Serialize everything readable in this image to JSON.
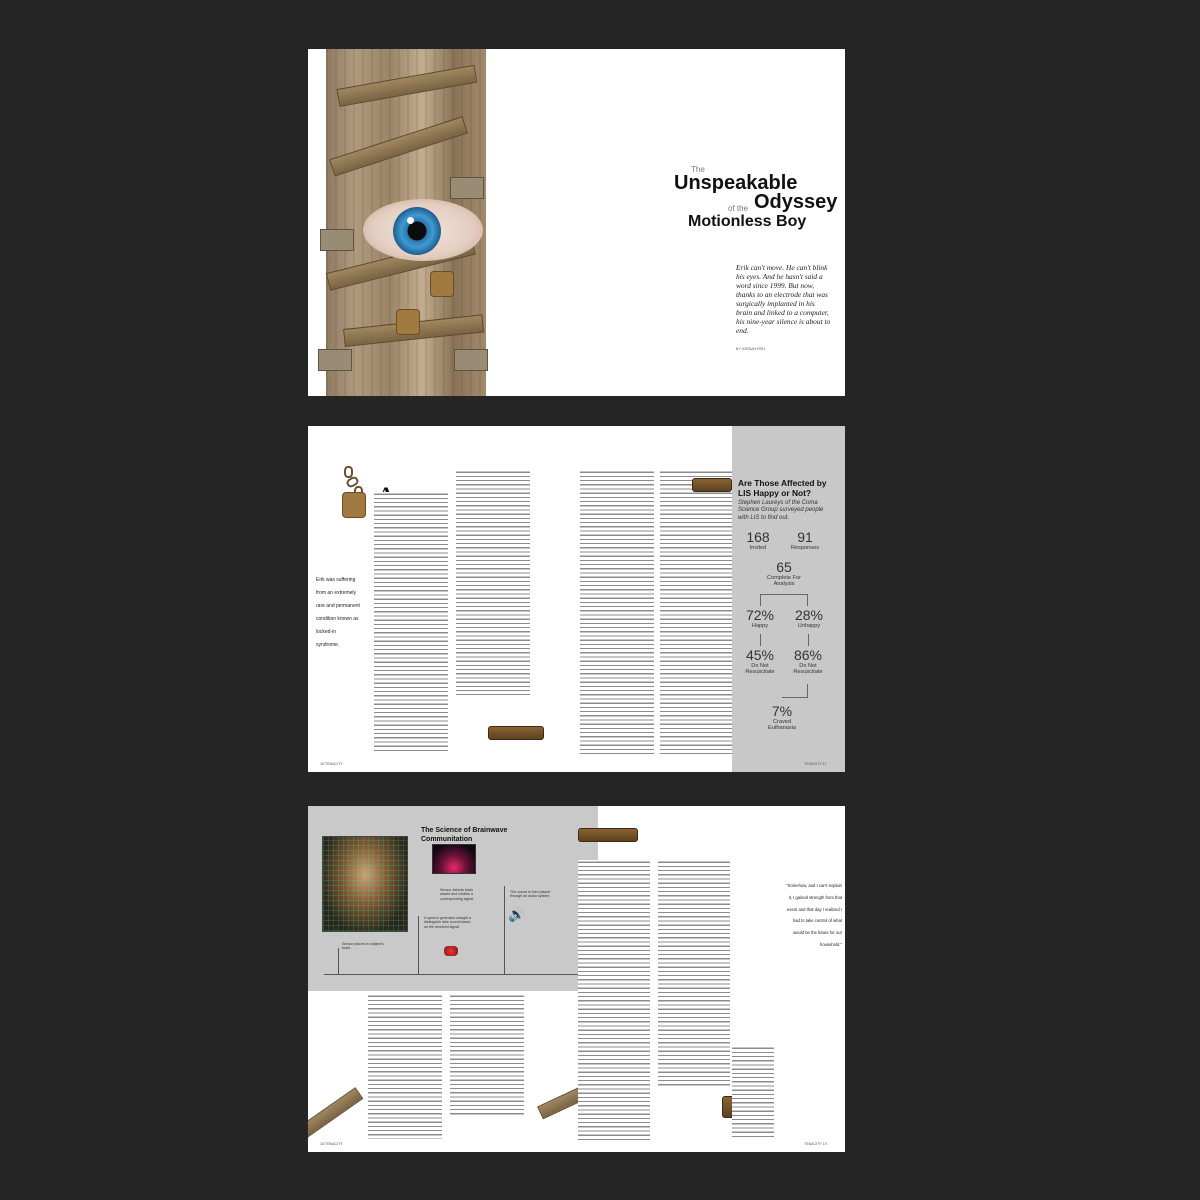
{
  "spread1": {
    "title_the": "The",
    "title_line1": "Unspeakable",
    "title_of_the": "of the",
    "title_line2": "Odyssey",
    "title_line3": "Motionless Boy",
    "deck": "Erik can't move. He can't blink his eyes. And he hasn't said a word since 1999. But now, thanks to an electrode that was surgically implanted in his brain and linked to a computer, his nine-year silence is about to end.",
    "byline": "BY JORDAN FISH"
  },
  "spread2": {
    "dropcap": "A",
    "pull_quote": "Erik was suffering from an extremely rare and permanent condition known as locked-in syndrome.",
    "sidebar": {
      "title": "Are Those Affected by LIS Happy or Not?",
      "subtitle": "Stephen Laureys of the Coma Science Group surveyed people with LIS to find out.",
      "stats": {
        "invited_n": "168",
        "invited_l": "Invited",
        "responses_n": "91",
        "responses_l": "Responses",
        "complete_n": "65",
        "complete_l": "Complete For Analysis",
        "happy_n": "72%",
        "happy_l": "Happy",
        "unhappy_n": "28%",
        "unhappy_l": "Unhappy",
        "dnr1_n": "45%",
        "dnr1_l": "Do Not Resuscitate",
        "dnr2_n": "86%",
        "dnr2_l": "Do Not Resuscitate",
        "craved_n": "7%",
        "craved_l": "Craved Euthanasia"
      }
    },
    "folio_left": "16   TENACITY",
    "folio_right": "TENACITY   17"
  },
  "spread3": {
    "title": "The Science of Brainwave Communitation",
    "cap_sensor": "Sensor placed in subject's brain.",
    "cap_detects": "Sensor detects brain waves and creates a corresponding signal.",
    "cap_speech": "A speech generator straight a distinguish able sound based on the received signal.",
    "cap_sound": "The sound is then played through an audio system.",
    "pull_quote": "\"Somehow, and I can't explain it, I gained strength from that event and that day I realized I had to take control of what would be the future for our household.\"",
    "folio_left": "18   TENACITY",
    "folio_right": "TENACITY   19"
  }
}
